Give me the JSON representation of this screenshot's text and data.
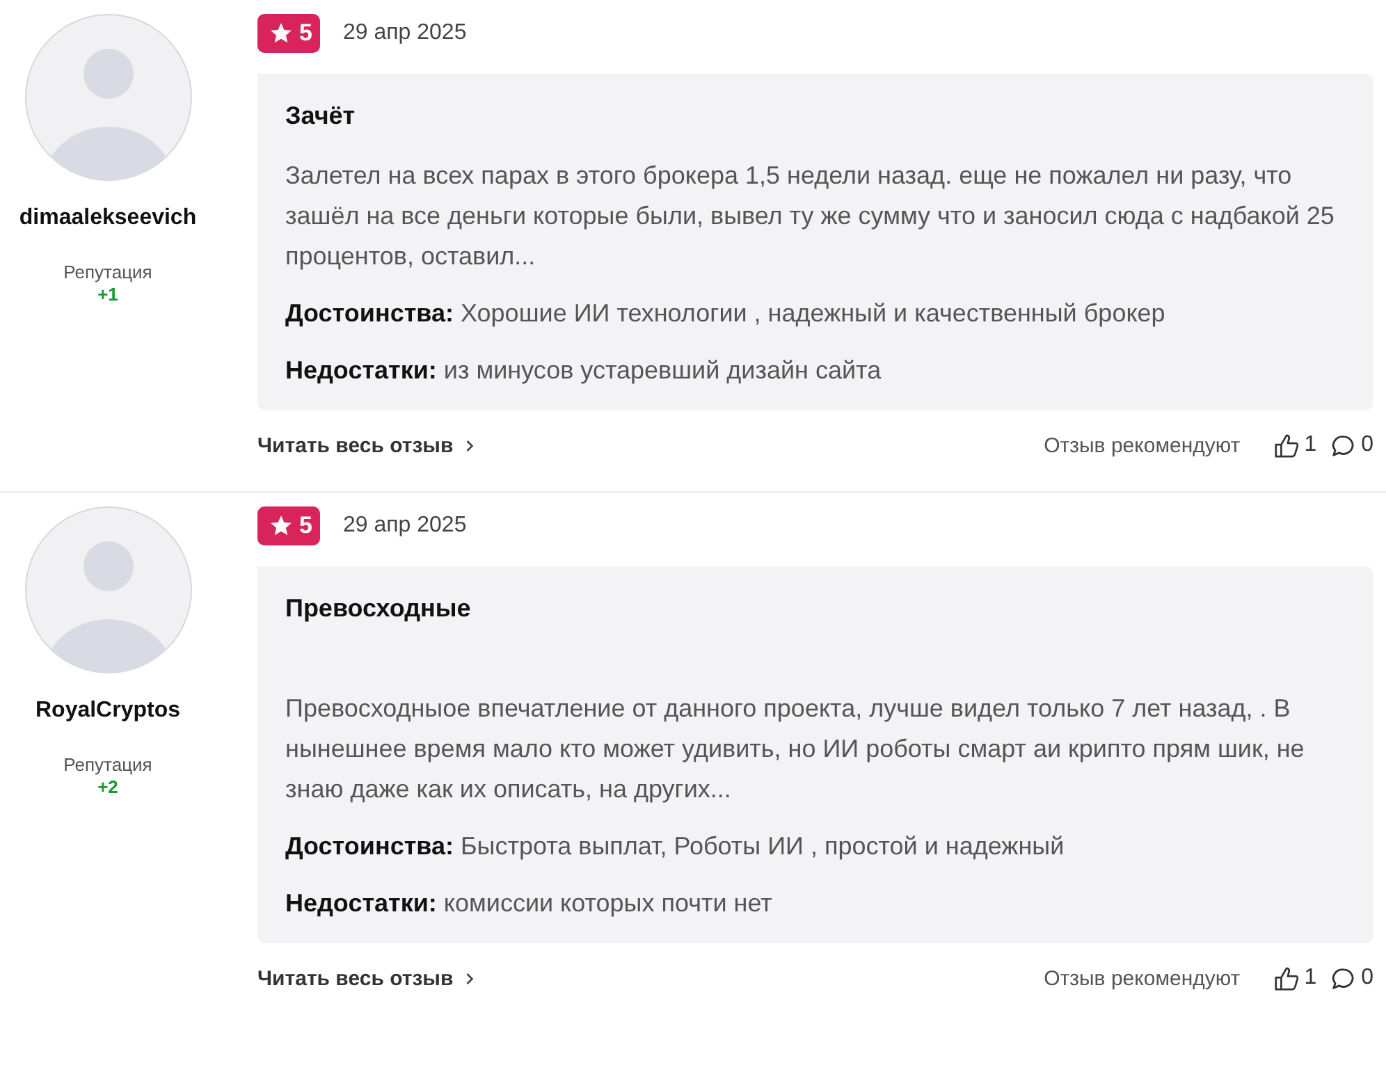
{
  "reviews": [
    {
      "author": "dimaalekseevich",
      "reputation_label": "Репутация",
      "reputation": "+1",
      "rating": "5",
      "date": "29 апр 2025",
      "title": "Зачёт",
      "text": "Залетел на всех парах в этого брокера 1,5 недели назад. еще не пожалел ни разу, что зашёл на все деньги которые были, вывел ту же сумму что и заносил сюда с надбакой 25 процентов, оставил...",
      "pros_label": "Достоинства:",
      "pros": "Хорошие ИИ технологии , надежный и качественный брокер",
      "cons_label": "Недостатки:",
      "cons": "из минусов устаревший дизайн сайта",
      "read_more": "Читать весь отзыв",
      "recommend_label": "Отзыв рекомендуют",
      "likes": "1",
      "comments": "0"
    },
    {
      "author": "RoyalCryptos",
      "reputation_label": "Репутация",
      "reputation": "+2",
      "rating": "5",
      "date": "29 апр 2025",
      "title": "Превосходные",
      "text": "\nПревосходныое впечатление от данного проекта, лучше видел только 7 лет назад, . В нынешнее время мало кто может удивить, но ИИ роботы смарт аи крипто прям шик, не знаю даже как их описать, на других...",
      "pros_label": "Достоинства:",
      "pros": "Быстрота выплат, Роботы ИИ , простой и надежный",
      "cons_label": "Недостатки:",
      "cons": "комиссии которых почти нет",
      "read_more": "Читать весь отзыв",
      "recommend_label": "Отзыв рекомендуют",
      "likes": "1",
      "comments": "0"
    }
  ]
}
